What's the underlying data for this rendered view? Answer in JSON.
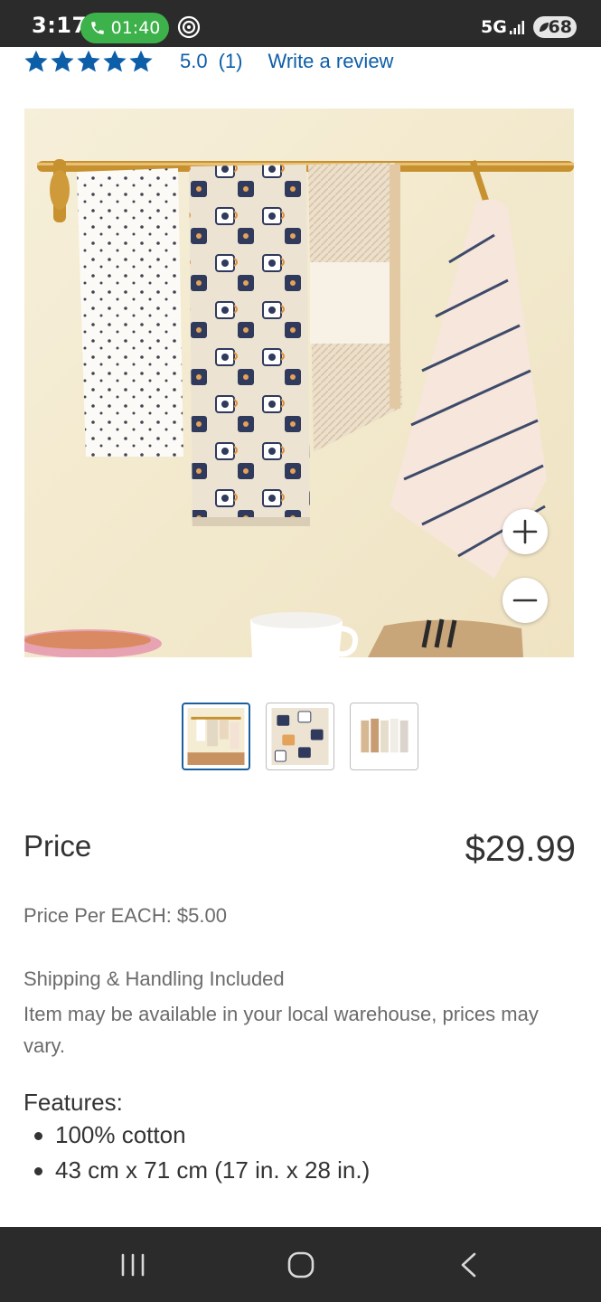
{
  "status_bar": {
    "time": "3:17",
    "call_timer": "01:40",
    "network": "5G",
    "battery": "68"
  },
  "rating": {
    "stars": 5,
    "value": "5.0",
    "count": "(1)",
    "write_review": "Write a review",
    "color": "#0d5ea8"
  },
  "gallery": {
    "thumbnails": 3,
    "active_index": 0,
    "icons": [
      "zoom-in-icon",
      "zoom-out-icon"
    ]
  },
  "price": {
    "label": "Price",
    "value": "$29.99",
    "per_each": "Price Per EACH: $5.00",
    "shipping": "Shipping & Handling Included",
    "warehouse_note": "Item may be available in your local warehouse, prices may vary."
  },
  "features": {
    "title": "Features:",
    "items": [
      "100% cotton",
      "43 cm x 71 cm (17 in. x 28 in.)"
    ]
  },
  "nav_bar": {
    "icons": [
      "recents-icon",
      "home-icon",
      "back-icon"
    ]
  }
}
